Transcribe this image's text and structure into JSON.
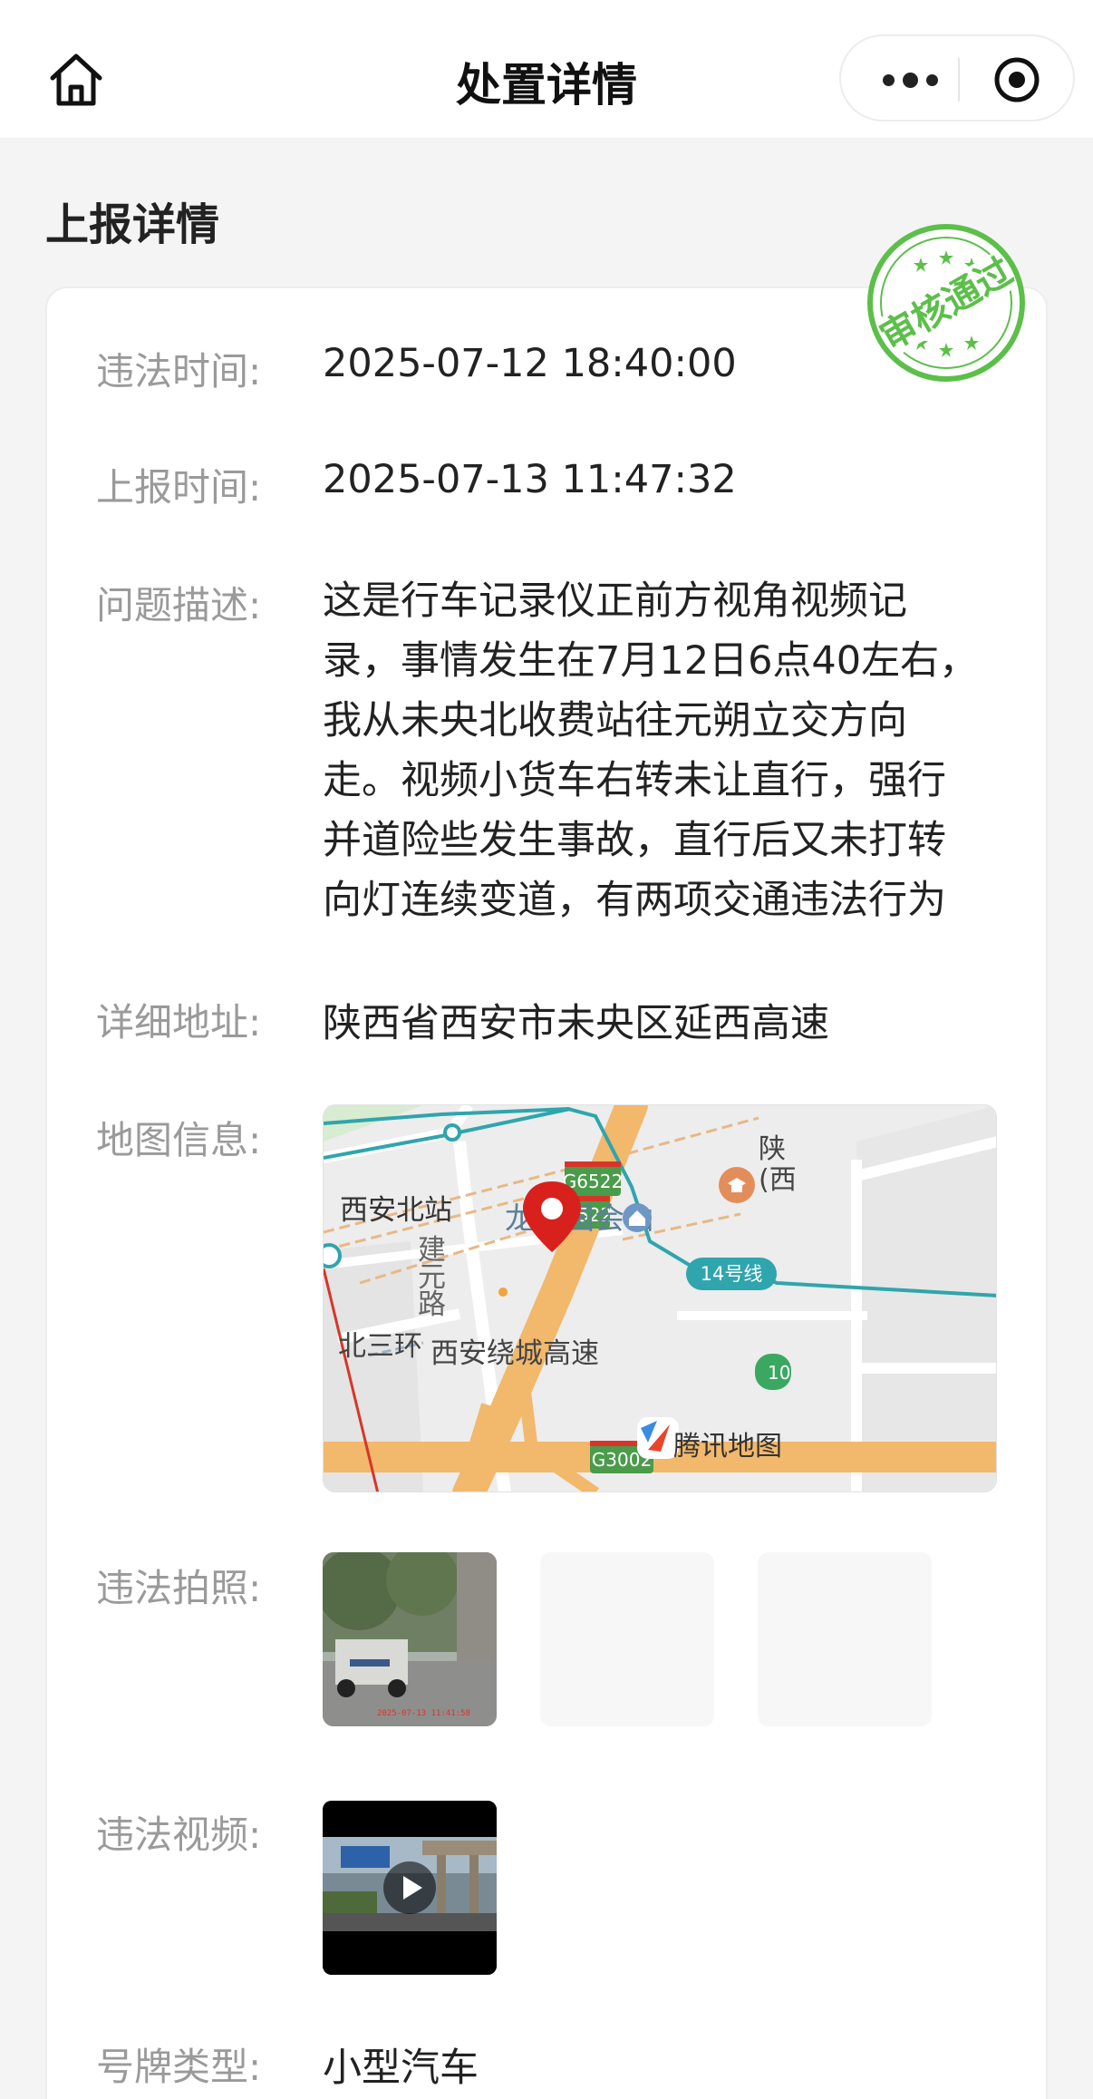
{
  "header": {
    "title": "处置详情",
    "home_icon": "home-icon",
    "more_icon": "more-dots-icon",
    "close_icon": "target-close-icon"
  },
  "section": {
    "title": "上报详情"
  },
  "stamp": {
    "text": "审核通过",
    "color": "#5cbf4a"
  },
  "details": {
    "violation_time": {
      "label": "违法时间:",
      "value": "2025-07-12 18:40:00"
    },
    "report_time": {
      "label": "上报时间:",
      "value": "2025-07-13 11:47:32"
    },
    "description": {
      "label": "问题描述:",
      "lines": [
        "这是行车记录仪正前方视角视频记",
        "录，事情发生在7月12日6点40左右，",
        "我从未央北收费站往元朔立交方向",
        "走。视频小货车右转未让直行，强行",
        "并道险些发生事故，直行后又未打转",
        "向灯连续变道，有两项交通违法行为"
      ]
    },
    "address": {
      "label": "详细地址:",
      "value": "陕西省西安市未央区延西高速"
    },
    "map": {
      "label": "地图信息:",
      "labels": {
        "station": "西安北站",
        "road_jianyuan": [
          "建",
          "元",
          "路"
        ],
        "poi": "龙记国会山",
        "ring": "北三环",
        "highway": "西安绕城高速",
        "g6522a": "G6522",
        "g6522b": "G6522",
        "g3002": "G3002",
        "line14": "14号线",
        "edge_shaan": "陕",
        "edge_paren": "(西",
        "edge_10": "10",
        "brand": "腾讯地图"
      }
    },
    "photos": {
      "label": "违法拍照:",
      "timestamp": "2025-07-13 11:41:58"
    },
    "video": {
      "label": "违法视频:"
    },
    "plate_type": {
      "label": "号牌类型:",
      "value": "小型汽车"
    }
  }
}
